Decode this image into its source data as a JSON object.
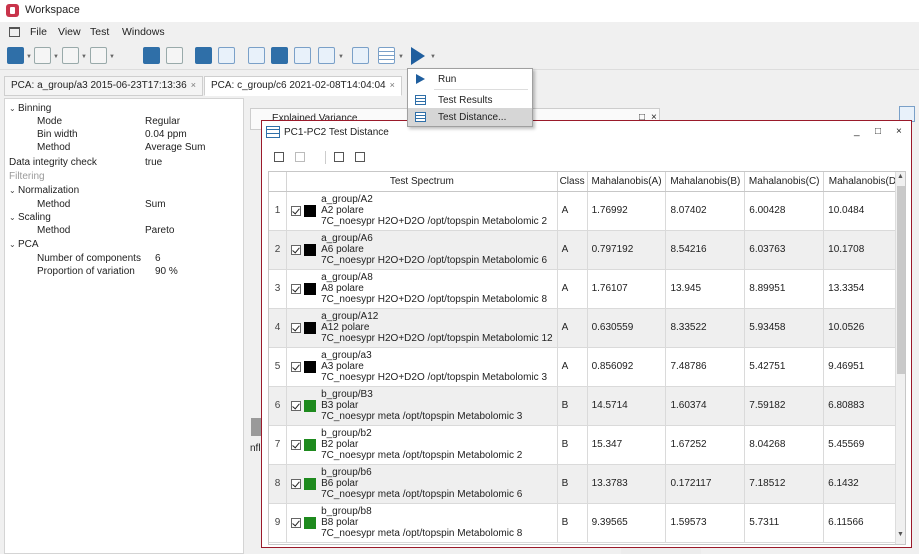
{
  "window": {
    "title": "Workspace"
  },
  "menu": {
    "items": [
      "File",
      "View",
      "Test",
      "Windows"
    ]
  },
  "toolbar": {
    "run_icon": "play-triangle-icon"
  },
  "tabs": [
    {
      "label": "PCA: a_group/a3 2015-06-23T17:13:36",
      "close": "×"
    },
    {
      "label": "PCA: c_group/c6 2021-02-08T14:04:04",
      "close": "×"
    }
  ],
  "left_panel": {
    "rows": [
      {
        "label": "Binning",
        "value": "",
        "toggle": "⌄"
      },
      {
        "label": "Mode",
        "value": "Regular",
        "toggle": ""
      },
      {
        "label": "Bin width",
        "value": "0.04 ppm",
        "toggle": ""
      },
      {
        "label": "Method",
        "value": "Average Sum",
        "toggle": ""
      },
      {
        "label": "Data integrity check",
        "value": "true",
        "toggle": ""
      },
      {
        "label": "Filtering",
        "value": "",
        "toggle": ""
      },
      {
        "label": "Normalization",
        "value": "",
        "toggle": "⌄"
      },
      {
        "label": "Method",
        "value": "Sum",
        "toggle": ""
      },
      {
        "label": "Scaling",
        "value": "",
        "toggle": "⌄"
      },
      {
        "label": "Method",
        "value": "Pareto",
        "toggle": ""
      },
      {
        "label": "PCA",
        "value": "",
        "toggle": "⌄"
      },
      {
        "label": "Number of components",
        "value": "6",
        "toggle": ""
      },
      {
        "label": "Proportion of variation",
        "value": "90 %",
        "toggle": ""
      }
    ]
  },
  "background_window": {
    "title": "Explained Variance",
    "minimize": "_",
    "maximize": "□",
    "close": "×",
    "partial_text": "nflu"
  },
  "dropdown": {
    "items": [
      "Run",
      "Test Results",
      "Test Distance..."
    ],
    "highlighted": "Test Distance..."
  },
  "dist_window": {
    "title": "PC1-PC2 Test Distance",
    "minimize": "_",
    "maximize": "□",
    "close": "×"
  },
  "table": {
    "headers": [
      "",
      "Test Spectrum",
      "Class",
      "Mahalanobis(A)",
      "Mahalanobis(B)",
      "Mahalanobis(C)",
      "Mahalanobis(D)"
    ],
    "rows": [
      {
        "n": "1",
        "group": "a_group/A2",
        "name": "A2 polare",
        "desc": "7C_noesypr H2O+D2O /opt/topspin Metabolomic 2",
        "cls": "A",
        "a": "1.76992",
        "b": "8.07402",
        "c": "6.00428",
        "d": "10.0484",
        "color": "#000000"
      },
      {
        "n": "2",
        "group": "a_group/A6",
        "name": "A6 polare",
        "desc": "7C_noesypr H2O+D2O /opt/topspin Metabolomic 6",
        "cls": "A",
        "a": "0.797192",
        "b": "8.54216",
        "c": "6.03763",
        "d": "10.1708",
        "color": "#000000"
      },
      {
        "n": "3",
        "group": "a_group/A8",
        "name": "A8 polare",
        "desc": "7C_noesypr H2O+D2O /opt/topspin Metabolomic 8",
        "cls": "A",
        "a": "1.76107",
        "b": "13.945",
        "c": "8.89951",
        "d": "13.3354",
        "color": "#000000"
      },
      {
        "n": "4",
        "group": "a_group/A12",
        "name": "A12 polare",
        "desc": "7C_noesypr H2O+D2O /opt/topspin Metabolomic 12",
        "cls": "A",
        "a": "0.630559",
        "b": "8.33522",
        "c": "5.93458",
        "d": "10.0526",
        "color": "#000000"
      },
      {
        "n": "5",
        "group": "a_group/a3",
        "name": "A3 polare",
        "desc": "7C_noesypr H2O+D2O /opt/topspin Metabolomic 3",
        "cls": "A",
        "a": "0.856092",
        "b": "7.48786",
        "c": "5.42751",
        "d": "9.46951",
        "color": "#000000"
      },
      {
        "n": "6",
        "group": "b_group/B3",
        "name": "B3 polar",
        "desc": "7C_noesypr meta /opt/topspin Metabolomic 3",
        "cls": "B",
        "a": "14.5714",
        "b": "1.60374",
        "c": "7.59182",
        "d": "6.80883",
        "color": "#1e8a1e"
      },
      {
        "n": "7",
        "group": "b_group/b2",
        "name": "B2 polar",
        "desc": "7C_noesypr meta /opt/topspin Metabolomic 2",
        "cls": "B",
        "a": "15.347",
        "b": "1.67252",
        "c": "8.04268",
        "d": "5.45569",
        "color": "#1e8a1e"
      },
      {
        "n": "8",
        "group": "b_group/b6",
        "name": "B6 polar",
        "desc": "7C_noesypr meta /opt/topspin Metabolomic 6",
        "cls": "B",
        "a": "13.3783",
        "b": "0.172117",
        "c": "7.18512",
        "d": "6.1432",
        "color": "#1e8a1e"
      },
      {
        "n": "9",
        "group": "b_group/b8",
        "name": "B8 polar",
        "desc": "7C_noesypr meta /opt/topspin Metabolomic 8",
        "cls": "B",
        "a": "9.39565",
        "b": "1.59573",
        "c": "5.7311",
        "d": "6.11566",
        "color": "#1e8a1e"
      }
    ]
  }
}
